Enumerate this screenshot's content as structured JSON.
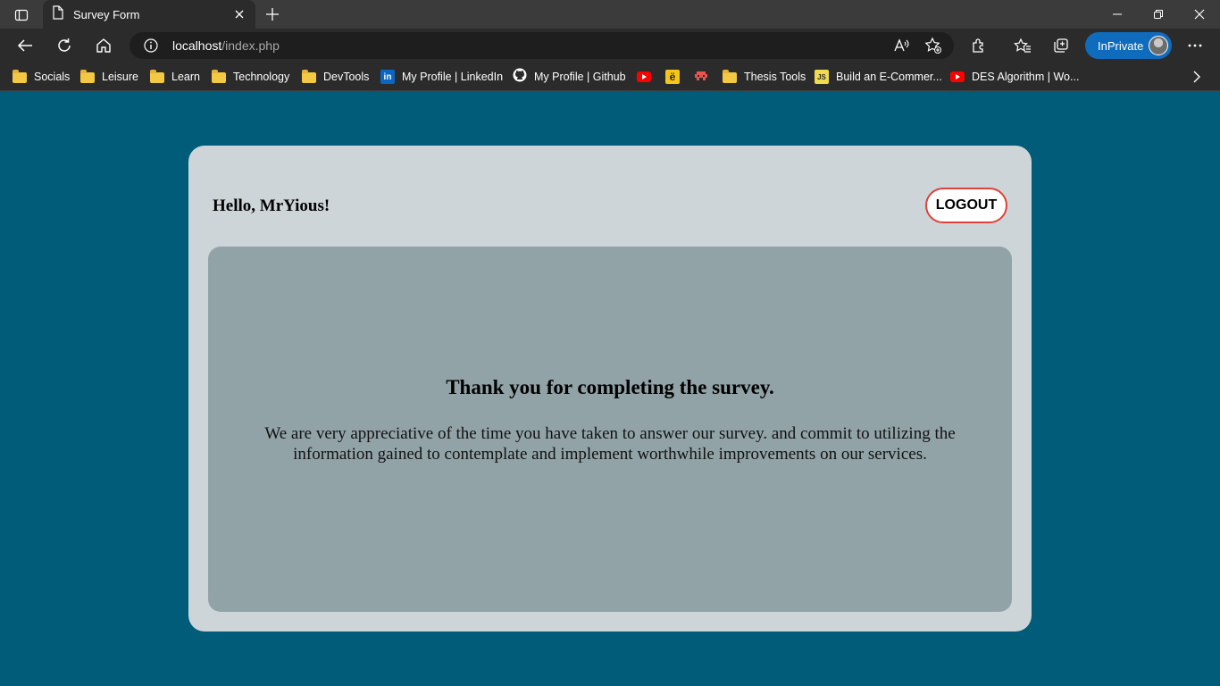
{
  "browser": {
    "tab": {
      "title": "Survey Form"
    },
    "address": {
      "host": "localhost",
      "path": "/index.php"
    },
    "inprivate_label": "InPrivate",
    "bookmarks": [
      {
        "label": "Socials",
        "icon": "folder-icon"
      },
      {
        "label": "Leisure",
        "icon": "folder-icon"
      },
      {
        "label": "Learn",
        "icon": "folder-icon"
      },
      {
        "label": "Technology",
        "icon": "folder-icon"
      },
      {
        "label": "DevTools",
        "icon": "folder-icon"
      },
      {
        "label": "My Profile | LinkedIn",
        "icon": "linkedin-icon"
      },
      {
        "label": "My Profile | Github",
        "icon": "github-icon"
      },
      {
        "label": "",
        "icon": "youtube-icon"
      },
      {
        "label": "",
        "icon": "e-icon"
      },
      {
        "label": "",
        "icon": "pixel-icon"
      },
      {
        "label": "Thesis Tools",
        "icon": "folder-icon"
      },
      {
        "label": "Build an E-Commer...",
        "icon": "js-icon"
      },
      {
        "label": "DES Algorithm | Wo...",
        "icon": "youtube-icon"
      }
    ],
    "colors": {
      "accent": "#0f6cbd",
      "tab_bg": "#2b2b2b",
      "frame_bg": "#3b3b3b"
    }
  },
  "page": {
    "greeting": "Hello, MrYious!",
    "logout_label": "LOGOUT",
    "thanks_title": "Thank you for completing the survey.",
    "message": "We are very appreciative of the time you have taken to answer our survey. and commit to utilizing the information gained to contemplate and implement worthwhile improvements on our services.",
    "colors": {
      "background": "#005c79",
      "card": "#ced5d8",
      "panel": "#92a3a8",
      "logout_border": "#e0403a"
    }
  }
}
